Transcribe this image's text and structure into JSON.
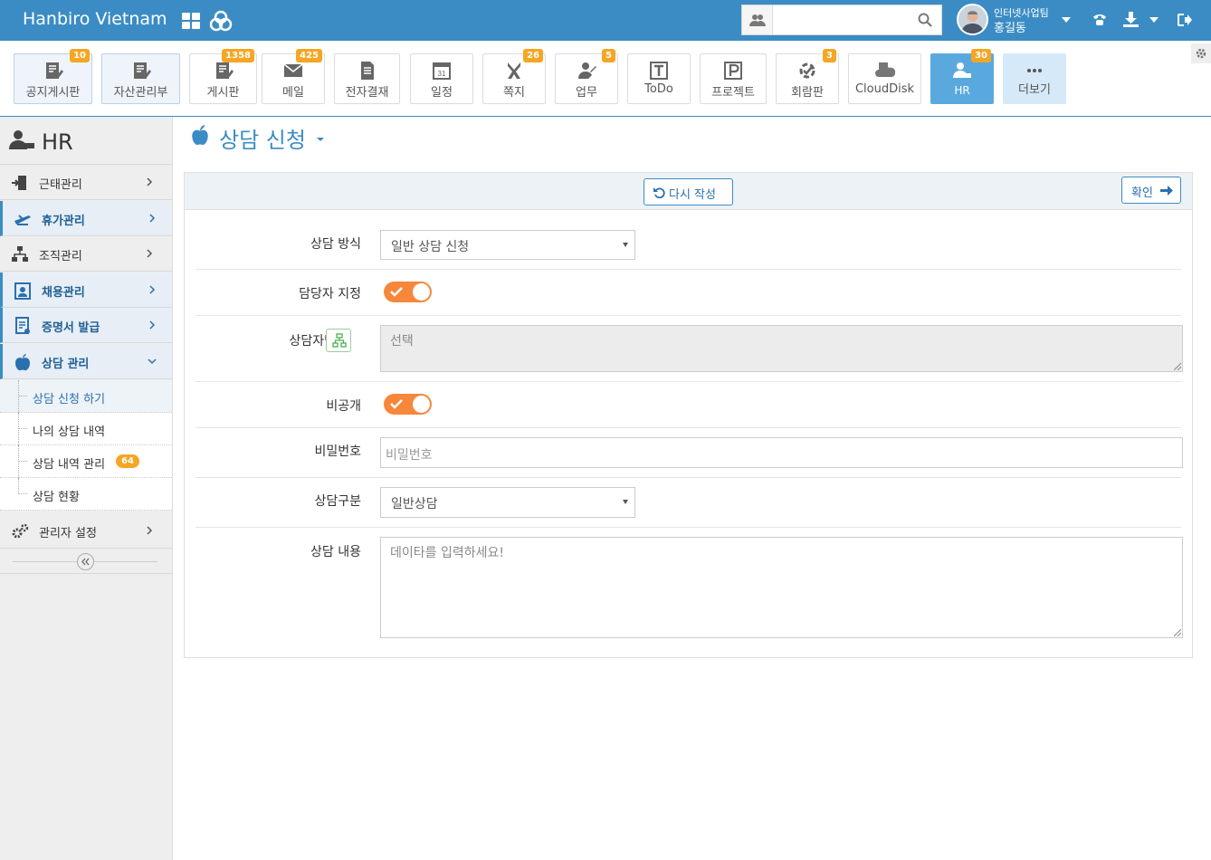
{
  "header": {
    "brand": "Hanbiro Vietnam",
    "search": {
      "placeholder": ""
    },
    "user": {
      "team": "인터넷사업팀",
      "name": "홍길동"
    }
  },
  "apps": [
    {
      "label": "공지게시판",
      "badge": "10",
      "icon": "notice-icon"
    },
    {
      "label": "자산관리부",
      "badge": "",
      "icon": "asset-icon"
    },
    {
      "label": "게시판",
      "badge": "1358",
      "icon": "board-icon"
    },
    {
      "label": "메일",
      "badge": "425",
      "icon": "mail-icon"
    },
    {
      "label": "전자결재",
      "badge": "",
      "icon": "approval-icon"
    },
    {
      "label": "일정",
      "badge": "",
      "icon": "calendar-icon",
      "day": "31"
    },
    {
      "label": "쪽지",
      "badge": "26",
      "icon": "memo-icon"
    },
    {
      "label": "업무",
      "badge": "5",
      "icon": "task-icon"
    },
    {
      "label": "ToDo",
      "badge": "",
      "icon": "todo-icon"
    },
    {
      "label": "프로젝트",
      "badge": "",
      "icon": "project-icon"
    },
    {
      "label": "회람판",
      "badge": "3",
      "icon": "circular-icon"
    },
    {
      "label": "CloudDisk",
      "badge": "",
      "icon": "clouddisk-icon"
    },
    {
      "label": "HR",
      "badge": "30",
      "icon": "hr-icon"
    },
    {
      "label": "더보기",
      "badge": "",
      "icon": "more-icon"
    }
  ],
  "sidebar": {
    "title": "HR",
    "items": [
      {
        "label": "근태관리",
        "icon": "attendance-icon"
      },
      {
        "label": "휴가관리",
        "icon": "vacation-icon"
      },
      {
        "label": "조직관리",
        "icon": "organization-icon"
      },
      {
        "label": "채용관리",
        "icon": "recruit-icon"
      },
      {
        "label": "증명서 발급",
        "icon": "certificate-icon"
      },
      {
        "label": "상담 관리",
        "icon": "apple-icon"
      }
    ],
    "subitems": [
      {
        "label": "상담 신청 하기",
        "badge": ""
      },
      {
        "label": "나의 상담 내역",
        "badge": ""
      },
      {
        "label": "상담 내역 관리",
        "badge": "64"
      },
      {
        "label": "상담 현황",
        "badge": ""
      }
    ],
    "admin": {
      "label": "관리자 설정"
    }
  },
  "page": {
    "title": "상담 신청"
  },
  "toolbar": {
    "reset_label": "다시 작성",
    "confirm_label": "확인"
  },
  "form": {
    "method": {
      "label": "상담 방식",
      "value": "일반 상담 신청"
    },
    "assign": {
      "label": "담당자 지정",
      "on": true
    },
    "counselor": {
      "label": "상담자명",
      "placeholder": "선택"
    },
    "private": {
      "label": "비공개",
      "on": true
    },
    "password": {
      "label": "비밀번호",
      "placeholder": "비밀번호"
    },
    "category": {
      "label": "상담구분",
      "value": "일반상담"
    },
    "content": {
      "label": "상담 내용",
      "placeholder": "데이타를 입력하세요!"
    }
  },
  "colors": {
    "header": "#3b8cc4",
    "accent": "#f7873a",
    "badge": "#f5a623"
  }
}
